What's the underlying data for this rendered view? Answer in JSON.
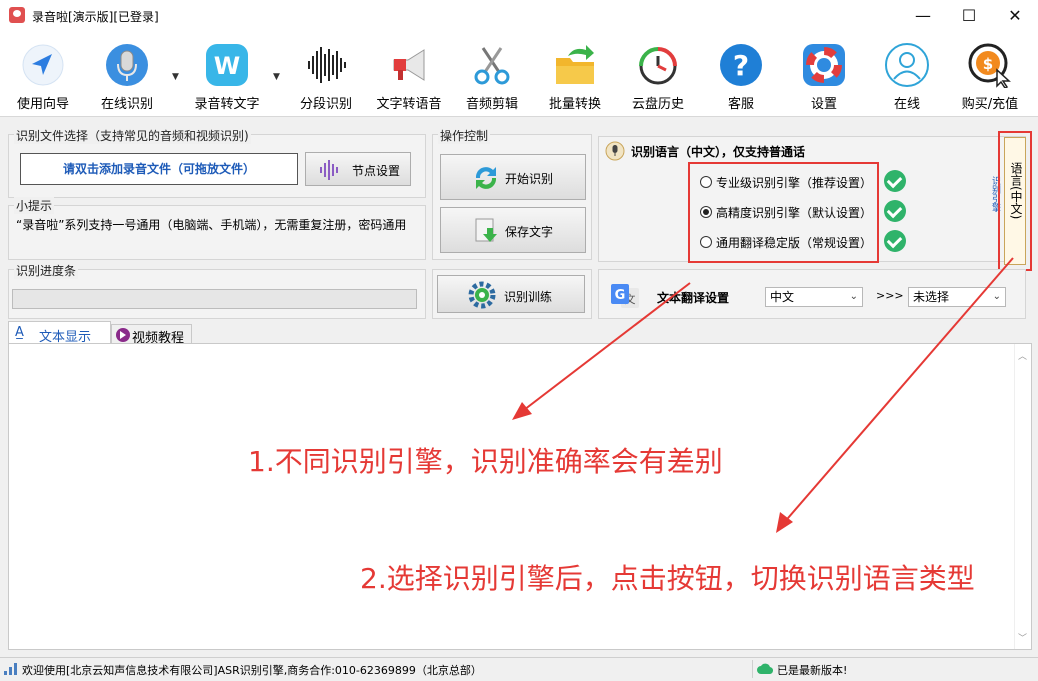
{
  "window": {
    "title": "录音啦[演示版][已登录]",
    "controls": {
      "minimize": "—",
      "maximize": "☐",
      "close": "✕"
    }
  },
  "toolbar": {
    "items": [
      {
        "label": "使用向导",
        "icon": "navigation-arrow-icon"
      },
      {
        "label": "在线识别",
        "icon": "microphone-icon"
      },
      {
        "label": "录音转文字",
        "icon": "w-logo-icon"
      },
      {
        "label": "分段识别",
        "icon": "waveform-icon"
      },
      {
        "label": "文字转语音",
        "icon": "megaphone-icon"
      },
      {
        "label": "音频剪辑",
        "icon": "scissors-icon"
      },
      {
        "label": "批量转换",
        "icon": "folder-arrow-icon"
      },
      {
        "label": "云盘历史",
        "icon": "clock-history-icon"
      },
      {
        "label": "客服",
        "icon": "question-icon"
      },
      {
        "label": "设置",
        "icon": "lifebuoy-icon"
      },
      {
        "label": "在线",
        "icon": "user-online-icon"
      },
      {
        "label": "购买/充值",
        "icon": "coin-cursor-icon"
      }
    ],
    "dropdown_glyph": "▼"
  },
  "file_select": {
    "title": "识别文件选择（支持常见的音频和视频识别)",
    "add_file_label": "请双击添加录音文件（可拖放文件）",
    "node_settings_label": "节点设置"
  },
  "tips": {
    "title": "小提示",
    "text": "“录音啦”系列支持一号通用（电脑端、手机端），无需重复注册，密码通用"
  },
  "progress": {
    "title": "识别进度条",
    "value": 0
  },
  "operation": {
    "title": "操作控制",
    "start_label": "开始识别",
    "save_label": "保存文字",
    "train_label": "识别训练"
  },
  "language_panel": {
    "title": "识别语言（中文），仅支持普通话",
    "options": [
      {
        "label": "专业级识别引擎（推荐设置）",
        "selected": false
      },
      {
        "label": "高精度识别引擎（默认设置）",
        "selected": true
      },
      {
        "label": "通用翻译稳定版（常规设置）",
        "selected": false
      }
    ],
    "side_vertical_text": "识别引擎",
    "lang_button_label": "语言(中文)"
  },
  "translate": {
    "label": "文本翻译设置",
    "source_value": "中文",
    "arrow": ">>>",
    "target_value": "未选择"
  },
  "tabs": [
    {
      "label": "文本显示",
      "active": true
    },
    {
      "label": "视频教程",
      "active": false
    }
  ],
  "annotations": {
    "note1": "1.不同识别引擎，识别准确率会有差别",
    "note2": "2.选择识别引擎后，点击按钮，切换识别语言类型"
  },
  "statusbar": {
    "left_text": "欢迎使用[北京云知声信息技术有限公司]ASR识别引擎,商务合作:010-62369899（北京总部）",
    "right_text": "已是最新版本!"
  },
  "colors": {
    "accent_blue": "#1e5bb8",
    "annotation_red": "#e53935",
    "check_green": "#2fb36a"
  }
}
